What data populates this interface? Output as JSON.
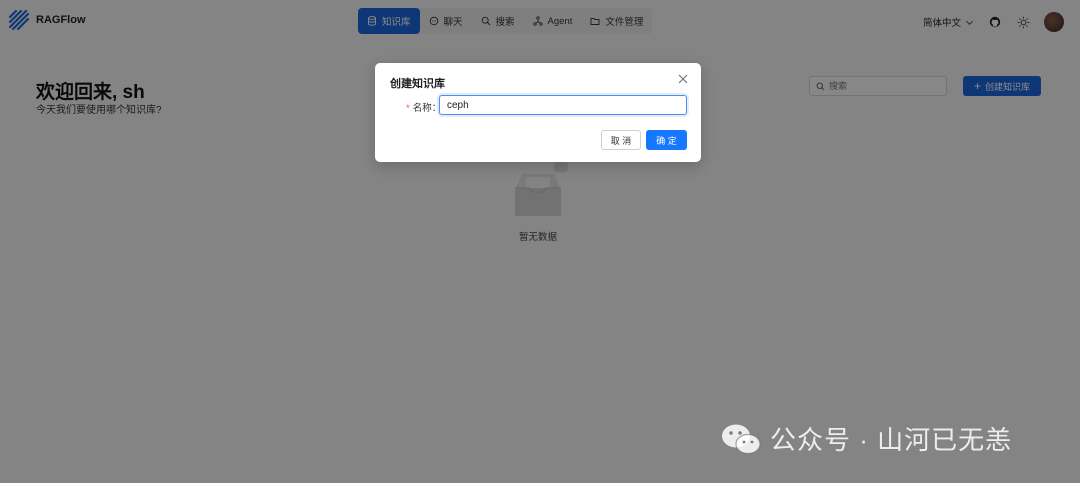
{
  "app": {
    "name": "RAGFlow"
  },
  "nav": {
    "items": [
      {
        "label": "知识库",
        "icon": "database-icon",
        "active": true
      },
      {
        "label": "聊天",
        "icon": "chat-icon",
        "active": false
      },
      {
        "label": "搜索",
        "icon": "search-icon",
        "active": false
      },
      {
        "label": "Agent",
        "icon": "graph-icon",
        "active": false
      },
      {
        "label": "文件管理",
        "icon": "folder-icon",
        "active": false
      }
    ]
  },
  "header": {
    "language": "简体中文"
  },
  "page": {
    "welcome": "欢迎回来, sh",
    "subtitle": "今天我们要使用哪个知识库?",
    "search_placeholder": "搜索",
    "create_button": "创建知识库",
    "empty_text": "暂无数据"
  },
  "modal": {
    "title": "创建知识库",
    "name_label": "名称",
    "name_value": "ceph",
    "cancel_label": "取 消",
    "ok_label": "确 定"
  },
  "watermark": {
    "text": "公众号 · 山河已无恙"
  },
  "colors": {
    "accent": "#1c65d6",
    "primary_button": "#1677ff",
    "required": "#ff4d4f"
  }
}
